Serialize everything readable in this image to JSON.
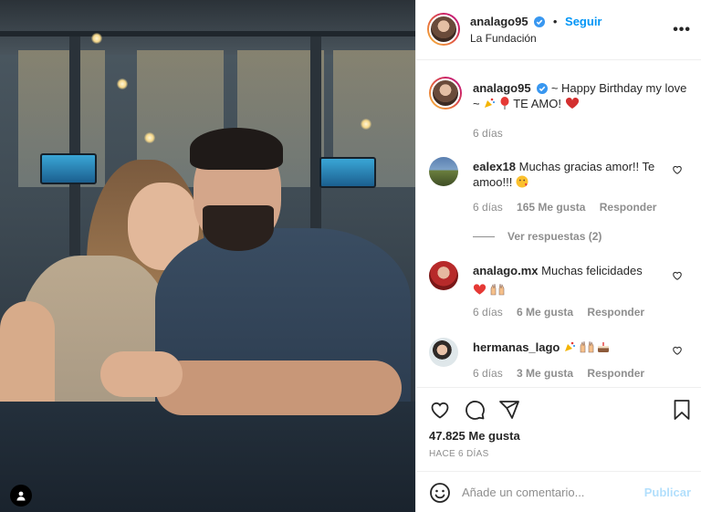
{
  "post": {
    "author": "analago95",
    "follow_label": "Seguir",
    "separator": "•",
    "location": "La Fundación",
    "more_label": "•••"
  },
  "caption": {
    "username": "analago95",
    "text": "~ Happy Birthday my love ~",
    "text2": "TE AMO!",
    "age": "6 días"
  },
  "comments": [
    {
      "username": "ealex18",
      "text": "Muchas gracias amor!! Te amoo!!!",
      "age": "6 días",
      "likes": "165 Me gusta",
      "reply_label": "Responder"
    },
    {
      "username": "analago.mx",
      "text": "Muchas felicidades",
      "age": "6 días",
      "likes": "6 Me gusta",
      "reply_label": "Responder"
    },
    {
      "username": "hermanas_lago",
      "text": "",
      "age": "6 días",
      "likes": "3 Me gusta",
      "reply_label": "Responder"
    }
  ],
  "view_replies": "Ver respuestas (2)",
  "likes_count": "47.825 Me gusta",
  "posted_ago": "HACE 6 DÍAS",
  "comment_box": {
    "placeholder": "Añade un comentario...",
    "post_label": "Publicar"
  },
  "colors": {
    "accent": "#0095f6",
    "muted": "#8e8e8e",
    "text": "#262626",
    "post_disabled": "#b2dffc"
  },
  "icons": [
    "verified-badge-icon",
    "heart-icon",
    "comment-icon",
    "share-icon",
    "bookmark-icon",
    "emoji-icon",
    "user-tag-icon",
    "more-icon"
  ]
}
